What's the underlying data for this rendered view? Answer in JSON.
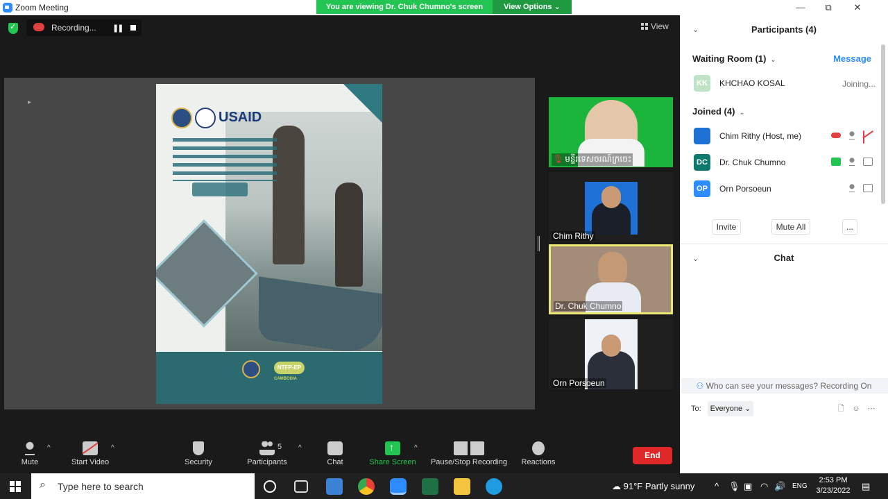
{
  "window": {
    "title": "Zoom Meeting",
    "viewing_banner": "You are viewing Dr. Chuk Chumno's screen",
    "view_options": "View Options",
    "view_options_caret": "⌄",
    "controls": {
      "minimize": "—",
      "restore": "⧉",
      "close": "✕"
    }
  },
  "meeting": {
    "recording_label": "Recording...",
    "pause_glyph": "❚❚",
    "view_label": "View",
    "shared_content": {
      "brand": "USAID",
      "footer_brand": "NTFP-EP",
      "footer_country": "CAMBODIA"
    },
    "tiles": [
      {
        "name": "មន្ទីរទេសចរណ៍ក្រចេះ",
        "muted": true,
        "mute_glyph": "🎙"
      },
      {
        "name": "Chim Rithy",
        "muted": false
      },
      {
        "name": "Dr. Chuk Chumno",
        "muted": false,
        "speaking": true
      },
      {
        "name": "Orn Porsoeun",
        "muted": false
      }
    ]
  },
  "toolbar": {
    "caret": "^",
    "mute": "Mute",
    "start_video": "Start Video",
    "security": "Security",
    "participants": "Participants",
    "participants_count": "5",
    "chat": "Chat",
    "share_screen": "Share Screen",
    "pause_stop_recording": "Pause/Stop Recording",
    "reactions": "Reactions",
    "end": "End"
  },
  "panel": {
    "collapse_caret": "⌄",
    "participants_title": "Participants (4)",
    "waiting_room_title": "Waiting Room (1)",
    "message_link": "Message",
    "waiting": [
      {
        "initials": "KK",
        "name": "KHCHAO KOSAL",
        "status": "Joining...",
        "color": "#bfe3c7"
      }
    ],
    "joined_title": "Joined (4)",
    "joined": [
      {
        "initials": "",
        "name": "Chim Rithy (Host, me)",
        "color": "#1e72d6"
      },
      {
        "initials": "DC",
        "name": "Dr. Chuk Chumno",
        "color": "#0e7a6e"
      },
      {
        "initials": "OP",
        "name": "Orn Porsoeun",
        "color": "#2d8cff"
      }
    ],
    "invite": "Invite",
    "mute_all": "Mute All",
    "more": "...",
    "chat_title": "Chat",
    "notice": "Who can see your messages? Recording On",
    "to_label": "To:",
    "to_value": "Everyone ⌄",
    "chat_file_glyph": "🗋",
    "chat_emoji_glyph": "☺",
    "chat_more_glyph": "⋯"
  },
  "taskbar": {
    "search_placeholder": "Type here to search",
    "weather": "91°F  Partly sunny",
    "time": "2:53 PM",
    "date": "3/23/2022",
    "tray_glyphs": {
      "chevron": "^",
      "mic": "🎙",
      "monitor": "▣",
      "wifi": "◠",
      "volume": "🔊",
      "language": "ENG",
      "notifications": "▤"
    }
  },
  "colors": {
    "accent_green": "#23c552",
    "link_blue": "#2d8cff",
    "end_red": "#e02828",
    "speaker_highlight": "#e8e872"
  }
}
